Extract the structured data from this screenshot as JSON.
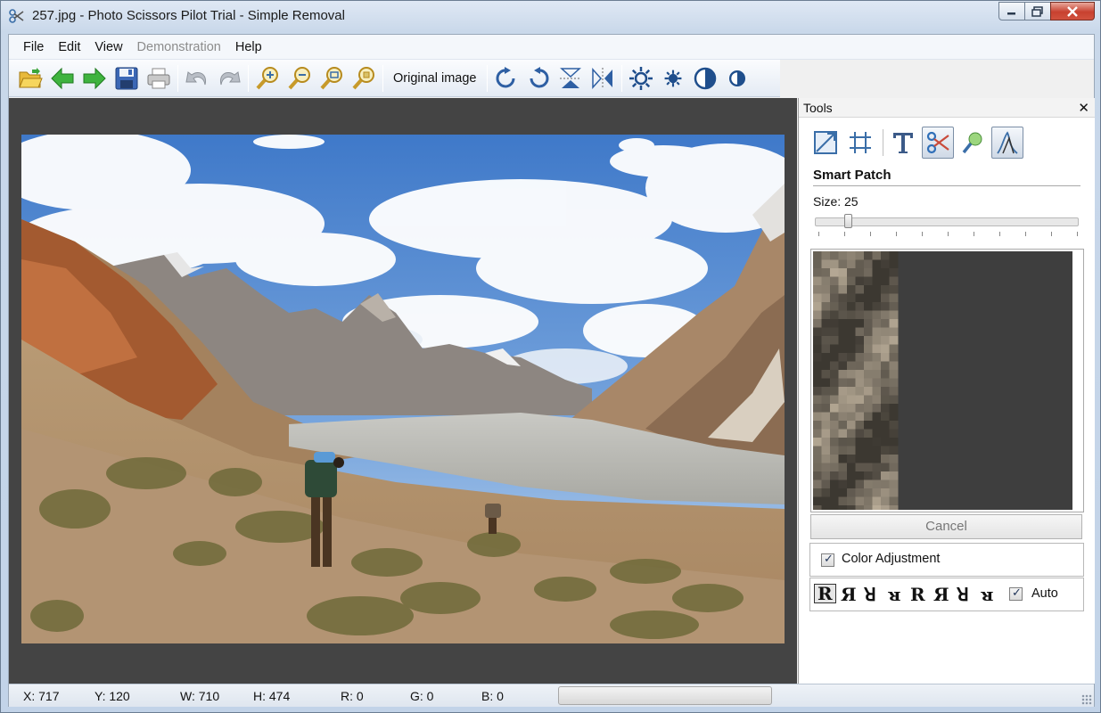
{
  "window": {
    "title": "257.jpg - Photo Scissors Pilot Trial - Simple Removal",
    "controls": [
      "minimize",
      "maximize",
      "close"
    ]
  },
  "menu": [
    {
      "label": "File",
      "enabled": true
    },
    {
      "label": "Edit",
      "enabled": true
    },
    {
      "label": "View",
      "enabled": true
    },
    {
      "label": "Demonstration",
      "enabled": false
    },
    {
      "label": "Help",
      "enabled": true
    }
  ],
  "toolbar": {
    "original_image_label": "Original image",
    "icons": [
      "open-folder-icon",
      "back-arrow-icon",
      "forward-arrow-icon",
      "save-icon",
      "print-icon",
      "undo-icon",
      "redo-icon",
      "zoom-in-icon",
      "zoom-out-icon",
      "zoom-fit-icon",
      "zoom-actual-icon",
      "rotate-clockwise-icon",
      "rotate-counterclockwise-icon",
      "flip-vertical-icon",
      "flip-horizontal-icon",
      "brightness-up-icon",
      "brightness-down-icon",
      "contrast-up-icon",
      "contrast-down-icon"
    ]
  },
  "tools_panel": {
    "title": "Tools",
    "close_symbol": "✕",
    "tool_icons": [
      "resize-icon",
      "crop-icon",
      "text-icon",
      "scissors-icon",
      "magic-wand-icon",
      "smart-patch-icon"
    ],
    "active_tool": "smart-patch-icon",
    "section_title": "Smart Patch",
    "size_label": "Size: 25",
    "size_value": 25,
    "cancel_label": "Cancel",
    "color_adjustment_label": "Color Adjustment",
    "color_adjustment_checked": true,
    "orientation_glyphs": [
      "R",
      "Я",
      "ꓤ",
      "ᴚ",
      "R",
      "Я",
      "ꓤ",
      "ᴚ"
    ],
    "auto_label": "Auto",
    "auto_checked": true
  },
  "statusbar": {
    "x": "X: 717",
    "y": "Y: 120",
    "w": "W: 710",
    "h": "H: 474",
    "r": "R: 0",
    "g": "G: 0",
    "b": "B: 0"
  },
  "colors": {
    "canvas_bg": "#444444",
    "accent": "#2f6fb8"
  }
}
